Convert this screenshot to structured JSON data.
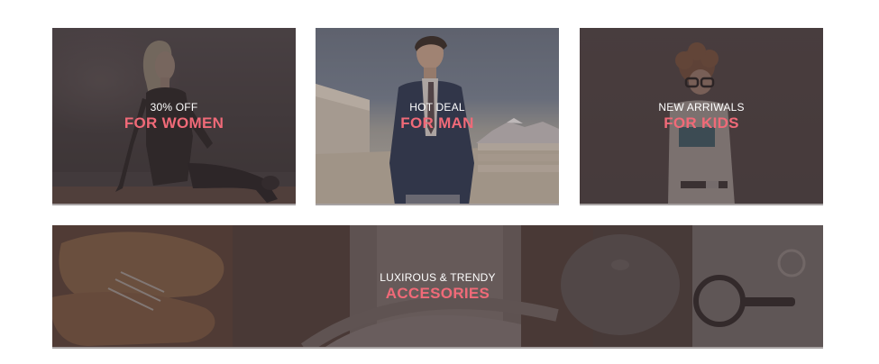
{
  "banners": [
    {
      "subtitle": "30% OFF",
      "title": "FOR WOMEN"
    },
    {
      "subtitle": "HOT DEAL",
      "title": "FOR MAN"
    },
    {
      "subtitle": "NEW ARRIWALS",
      "title": "FOR KIDS"
    },
    {
      "subtitle": "LUXIROUS & TRENDY",
      "title": "ACCESORIES"
    }
  ],
  "colors": {
    "accent": "#f06a78",
    "overlay": "#3a3032",
    "caption": "#ffffff",
    "border": "#a7a2a2"
  },
  "icons": [
    "woman-photo",
    "man-photo",
    "kid-photo",
    "accessories-photo"
  ]
}
